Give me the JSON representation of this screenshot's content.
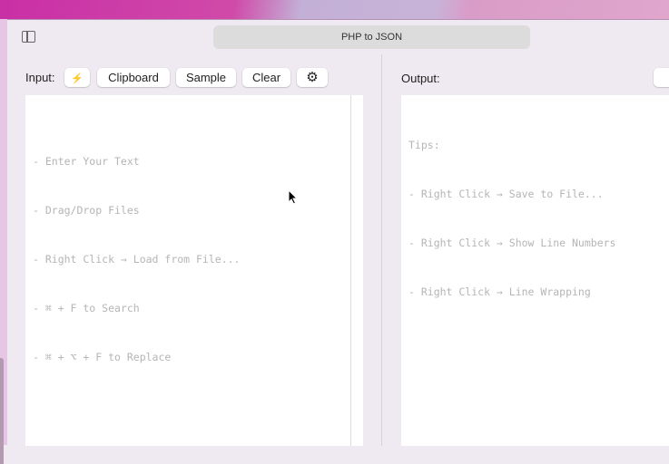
{
  "window": {
    "title": "PHP to JSON"
  },
  "input": {
    "label": "Input:",
    "buttons": {
      "run": "⚡",
      "clipboard": "Clipboard",
      "sample": "Sample",
      "clear": "Clear",
      "settings": "⚙"
    },
    "placeholder_lines": [
      "- Enter Your Text",
      "- Drag/Drop Files",
      "- Right Click → Load from File...",
      "- ⌘ + F to Search",
      "- ⌘ + ⌥ + F to Replace"
    ]
  },
  "output": {
    "label": "Output:",
    "placeholder_lines": [
      "Tips:",
      "- Right Click → Save to File...",
      "- Right Click → Show Line Numbers",
      "- Right Click → Line Wrapping"
    ]
  }
}
